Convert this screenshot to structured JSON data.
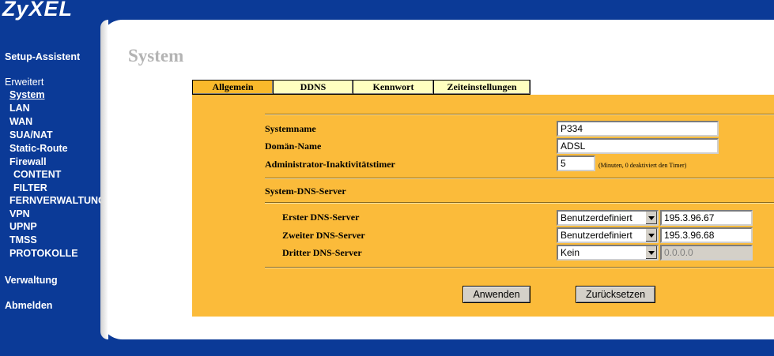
{
  "brand": {
    "logo": "ZyXEL"
  },
  "sidebar": {
    "setup": "Setup-Assistent",
    "erweitert": "Erweitert",
    "items": [
      "System",
      "LAN",
      "WAN",
      "SUA/NAT",
      "Static-Route",
      "Firewall",
      "CONTENT",
      "FILTER",
      "FERNVERWALTUNG",
      "VPN",
      "UPNP",
      "TMSS",
      "PROTOKOLLE"
    ],
    "verwaltung": "Verwaltung",
    "abmelden": "Abmelden"
  },
  "page": {
    "title": "System"
  },
  "tabs": [
    "Allgemein",
    "DDNS",
    "Kennwort",
    "Zeiteinstellungen"
  ],
  "form": {
    "systemname_label": "Systemname",
    "systemname_value": "P334",
    "domain_label": "Domän-Name",
    "domain_value": "ADSL",
    "timer_label": "Administrator-Inaktivitätstimer",
    "timer_value": "5",
    "timer_hint": "(Minuten, 0 deaktiviert den Timer)",
    "dns_section": "System-DNS-Server",
    "dns1_label": "Erster DNS-Server",
    "dns1_mode": "Benutzerdefiniert",
    "dns1_value": "195.3.96.67",
    "dns2_label": "Zweiter DNS-Server",
    "dns2_mode": "Benutzerdefiniert",
    "dns2_value": "195.3.96.68",
    "dns3_label": "Dritter DNS-Server",
    "dns3_mode": "Kein",
    "dns3_value": "0.0.0.0"
  },
  "buttons": {
    "apply": "Anwenden",
    "reset": "Zurücksetzen"
  },
  "colors": {
    "nav_bg": "#0b3a97",
    "content_bg": "#fbbb3a",
    "tab_active": "#f9b92b",
    "tab_inactive": "#ffffc0"
  }
}
